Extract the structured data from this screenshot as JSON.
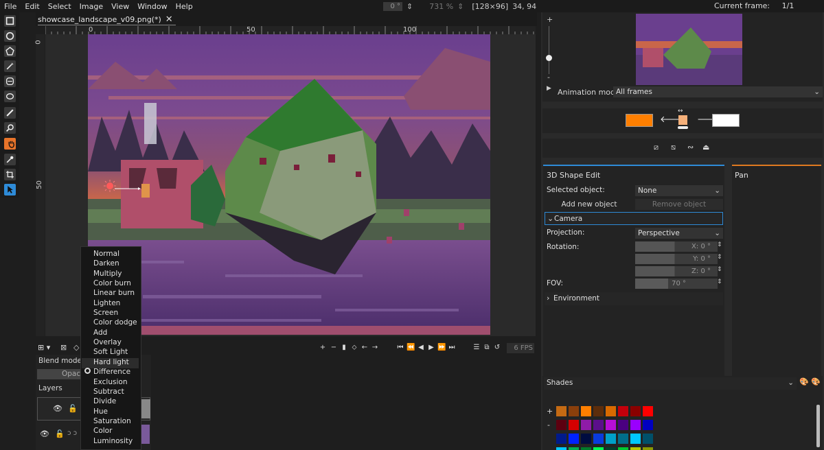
{
  "menubar": {
    "items": [
      "File",
      "Edit",
      "Select",
      "Image",
      "View",
      "Window",
      "Help"
    ],
    "rotation": "0 °",
    "zoom": "731 %",
    "size": "[128×96]",
    "cursor": "34, 94",
    "current_frame_label": "Current frame:",
    "current_frame_value": "1/1"
  },
  "tab": {
    "title": "showcase_landscape_v09.png(*)"
  },
  "ruler": {
    "h_labels": [
      "0",
      "50",
      "100"
    ],
    "v_labels": [
      "0",
      "50"
    ]
  },
  "toolbar": {
    "tools": [
      "rectangle-select-icon",
      "ellipse-select-icon",
      "polygon-select-icon",
      "magic-wand-icon",
      "lasso-icon",
      "pencil-icon",
      "zoom-icon",
      "pan-hand-icon",
      "color-picker-icon",
      "crop-icon",
      "cursor-icon"
    ],
    "active_left": "pan-hand-icon",
    "active_right": "cursor-icon"
  },
  "anim": {
    "fps": "6 FPS"
  },
  "layers": {
    "blend_mode_label": "Blend mode:",
    "opacity_label": "Opaci",
    "title": "Layers"
  },
  "blend_menu": {
    "items": [
      "Normal",
      "Darken",
      "Multiply",
      "Color burn",
      "Linear burn",
      "Lighten",
      "Screen",
      "Color dodge",
      "Add",
      "Overlay",
      "Soft Light",
      "Hard light",
      "Difference",
      "Exclusion",
      "Subtract",
      "Divide",
      "Hue",
      "Saturation",
      "Color",
      "Luminosity"
    ],
    "hovered": "Hard light",
    "selected": "Difference"
  },
  "preview": {
    "zoom_plus": "+",
    "zoom_minus": "-"
  },
  "animation_mode": {
    "label": "Animation mode:",
    "value": "All frames"
  },
  "colors": {
    "primary": "#ff7f00",
    "secondary": "#ffffff"
  },
  "shape_panel": {
    "title": "3D Shape Edit",
    "selected_object_label": "Selected object:",
    "selected_object_value": "None",
    "add_object": "Add new object",
    "remove_object": "Remove object",
    "camera_section": "Camera",
    "projection_label": "Projection:",
    "projection_value": "Perspective",
    "rotation_label": "Rotation:",
    "rot_x": "X: 0 °",
    "rot_y": "Y: 0 °",
    "rot_z": "Z: 0 °",
    "fov_label": "FOV:",
    "fov_value": "70 °",
    "environment_section": "Environment",
    "accent": "#2e8bd8"
  },
  "pan_panel": {
    "title": "Pan",
    "accent": "#e07a20"
  },
  "shades": {
    "title": "Shades",
    "rows": [
      [
        "#c46a13",
        "#8a3f0b",
        "#ff7f00",
        "#5c2d0b",
        "#d96a00",
        "#c4000b",
        "#8a0000",
        "#ff0000"
      ],
      [
        "#5c0010",
        "#d40000",
        "#8f1ba8",
        "#5b0f8a",
        "#b70fd6",
        "#4a0080",
        "#9a00ff",
        "#0000c0"
      ],
      [
        "#001a8a",
        "#0022ff",
        "#000c40",
        "#0a3bdd",
        "#00a0c8",
        "#006e8a",
        "#00c8ff",
        "#00506a"
      ],
      [
        "#00c8ff",
        "#00b050",
        "#007a2a",
        "#00ff55",
        "#00402a",
        "#00c830",
        "#b8c800",
        "#8a9a00"
      ]
    ]
  }
}
